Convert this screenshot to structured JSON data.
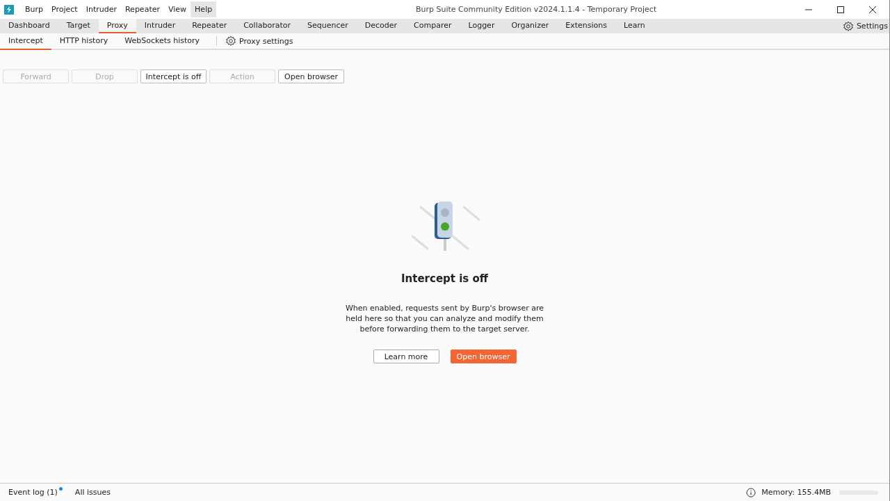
{
  "window": {
    "title": "Burp Suite Community Edition v2024.1.1.4 - Temporary Project"
  },
  "menu": [
    {
      "label": "Burp",
      "selected": false
    },
    {
      "label": "Project",
      "selected": false
    },
    {
      "label": "Intruder",
      "selected": false
    },
    {
      "label": "Repeater",
      "selected": false
    },
    {
      "label": "View",
      "selected": false
    },
    {
      "label": "Help",
      "selected": true
    }
  ],
  "tabs": [
    {
      "label": "Dashboard",
      "selected": false
    },
    {
      "label": "Target",
      "selected": false
    },
    {
      "label": "Proxy",
      "selected": true
    },
    {
      "label": "Intruder",
      "selected": false
    },
    {
      "label": "Repeater",
      "selected": false
    },
    {
      "label": "Collaborator",
      "selected": false
    },
    {
      "label": "Sequencer",
      "selected": false
    },
    {
      "label": "Decoder",
      "selected": false
    },
    {
      "label": "Comparer",
      "selected": false
    },
    {
      "label": "Logger",
      "selected": false
    },
    {
      "label": "Organizer",
      "selected": false
    },
    {
      "label": "Extensions",
      "selected": false
    },
    {
      "label": "Learn",
      "selected": false
    }
  ],
  "settings": {
    "label": "Settings"
  },
  "subtabs": [
    {
      "label": "Intercept",
      "selected": true
    },
    {
      "label": "HTTP history",
      "selected": false
    },
    {
      "label": "WebSockets history",
      "selected": false
    }
  ],
  "proxy_settings": {
    "label": "Proxy settings"
  },
  "toolbar": [
    {
      "label": "Forward",
      "disabled": true
    },
    {
      "label": "Drop",
      "disabled": true
    },
    {
      "label": "Intercept is off",
      "disabled": false
    },
    {
      "label": "Action",
      "disabled": true
    },
    {
      "label": "Open browser",
      "disabled": false
    }
  ],
  "empty_state": {
    "title": "Intercept is off",
    "text": "When enabled, requests sent by Burp's browser are held here so that you can analyze and modify them before forwarding them to the target server.",
    "buttons": [
      {
        "label": "Learn more",
        "kind": "secondary"
      },
      {
        "label": "Open browser",
        "kind": "primary"
      }
    ]
  },
  "status_bar": {
    "event_log": "Event log (1)",
    "event_log_unread": true,
    "all_issues": "All issues",
    "memory": "Memory: 155.4MB"
  }
}
